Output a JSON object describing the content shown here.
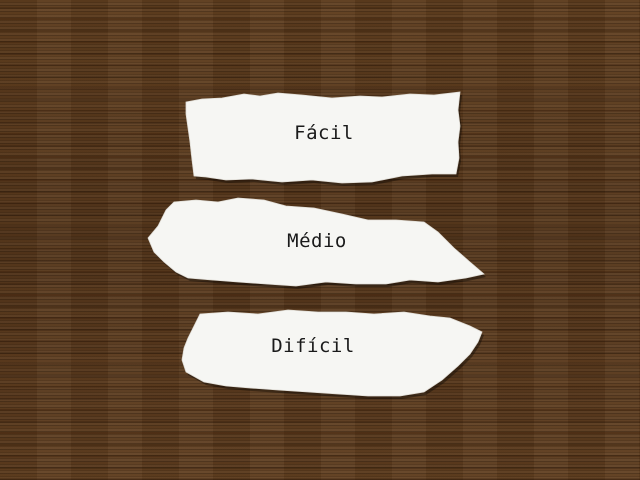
{
  "menu": {
    "options": [
      {
        "label": "Fácil"
      },
      {
        "label": "Médio"
      },
      {
        "label": "Difícil"
      }
    ]
  },
  "colors": {
    "background": "#5a3a1c",
    "paper": "#f6f6f3",
    "text": "#1a1a1a"
  }
}
